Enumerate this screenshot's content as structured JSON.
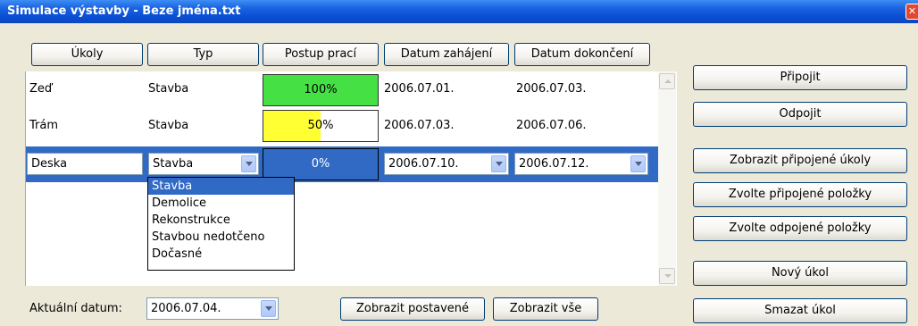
{
  "window": {
    "title": "Simulace výstavby - Beze jména.txt",
    "close_glyph": "✕"
  },
  "columns": [
    "Úkoly",
    "Typ",
    "Postup prací",
    "Datum zahájení",
    "Datum dokončení"
  ],
  "rows": [
    {
      "name": "Zeď",
      "type": "Stavba",
      "progress": "100%",
      "progress_value": 1.0,
      "progress_color": "#44e044",
      "start": "2006.07.01.",
      "end": "2006.07.03."
    },
    {
      "name": "Trám",
      "type": "Stavba",
      "progress": "50%",
      "progress_value": 0.5,
      "progress_color": "#ffff33",
      "start": "2006.07.03.",
      "end": "2006.07.06."
    },
    {
      "name": "Deska",
      "type": "Stavba",
      "progress": "0%",
      "progress_value": 0.0,
      "progress_color": "#316ac5",
      "start": "2006.07.10.",
      "end": "2006.07.12."
    }
  ],
  "type_dropdown": {
    "options": [
      "Stavba",
      "Demolice",
      "Rekonstrukce",
      "Stavbou nedotčeno",
      "Dočasné"
    ],
    "selected": "Stavba"
  },
  "right_buttons": {
    "attach": "Připojit",
    "detach": "Odpojit",
    "show_attached": "Zobrazit připojené úkoly",
    "select_attached": "Zvolte připojené položky",
    "select_detached": "Zvolte odpojené položky",
    "new_task": "Nový úkol",
    "delete_task": "Smazat úkol"
  },
  "bottom": {
    "current_date_label": "Aktuální datum:",
    "current_date": "2006.07.04.",
    "show_built": "Zobrazit postavené",
    "show_all": "Zobrazit vše"
  },
  "colors": {
    "selection": "#316ac5",
    "title_bar": "#0a4fd4",
    "window_bg": "#ece9d8"
  }
}
